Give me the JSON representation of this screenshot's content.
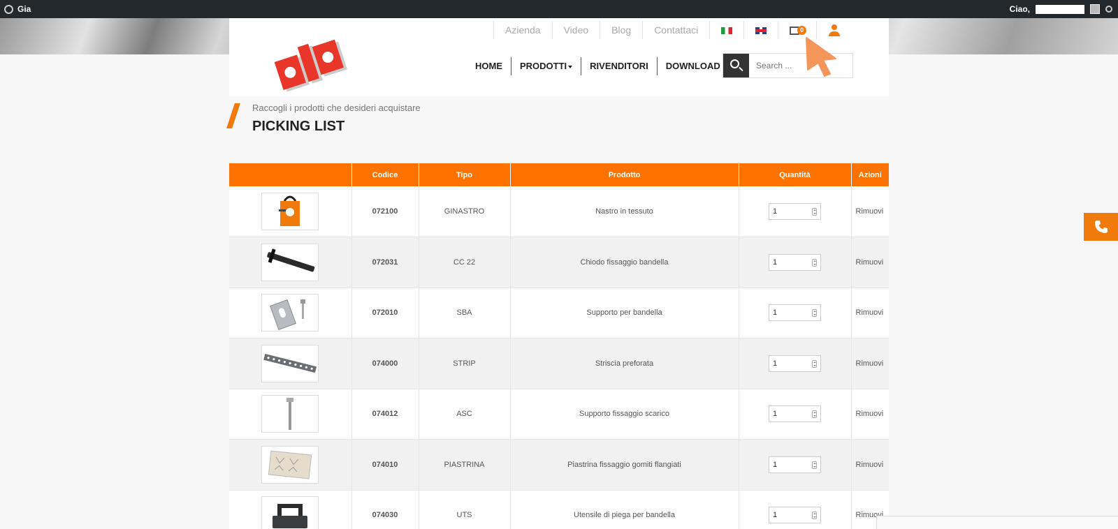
{
  "adminbar": {
    "site_name": "Gia",
    "greeting": "Ciao,"
  },
  "topnav": {
    "items": [
      "Azienda",
      "Video",
      "Blog",
      "Contattaci"
    ],
    "cart_count": "0"
  },
  "mainnav": {
    "items": [
      "HOME",
      "PRODOTTI",
      "RIVENDITORI",
      "DOWNLOAD"
    ]
  },
  "search": {
    "placeholder": "Search ..."
  },
  "page": {
    "subtitle": "Raccogli i prodotti che desideri acquistare",
    "title": "PICKING LIST"
  },
  "table": {
    "headers": [
      "",
      "Codice",
      "Tipo",
      "Prodotto",
      "Quantità",
      "Azioni"
    ],
    "remove_label": "Rimuovi",
    "rows": [
      {
        "codice": "072100",
        "tipo": "GINASTRO",
        "prodotto": "Nastro in tessuto",
        "qty": "1",
        "thumb": "bag-thumb"
      },
      {
        "codice": "072031",
        "tipo": "CC 22",
        "prodotto": "Chiodo fissaggio bandella",
        "qty": "1",
        "thumb": "nail-thumb"
      },
      {
        "codice": "072010",
        "tipo": "SBA",
        "prodotto": "Supporto per bandella",
        "qty": "1",
        "thumb": "bracket-thumb"
      },
      {
        "codice": "074000",
        "tipo": "STRIP",
        "prodotto": "Striscia preforata",
        "qty": "1",
        "thumb": "strip-thumb"
      },
      {
        "codice": "074012",
        "tipo": "ASC",
        "prodotto": "Supporto fissaggio scarico",
        "qty": "1",
        "thumb": "rod-thumb"
      },
      {
        "codice": "074010",
        "tipo": "PIASTRINA",
        "prodotto": "Piastrina fissaggio gomiti flangiati",
        "qty": "1",
        "thumb": "plate-thumb"
      },
      {
        "codice": "074030",
        "tipo": "UTS",
        "prodotto": "Utensile di piega per bandella",
        "qty": "1",
        "thumb": "tool-thumb"
      }
    ]
  },
  "colors": {
    "accent": "#ff7200",
    "dark": "#23282d"
  }
}
